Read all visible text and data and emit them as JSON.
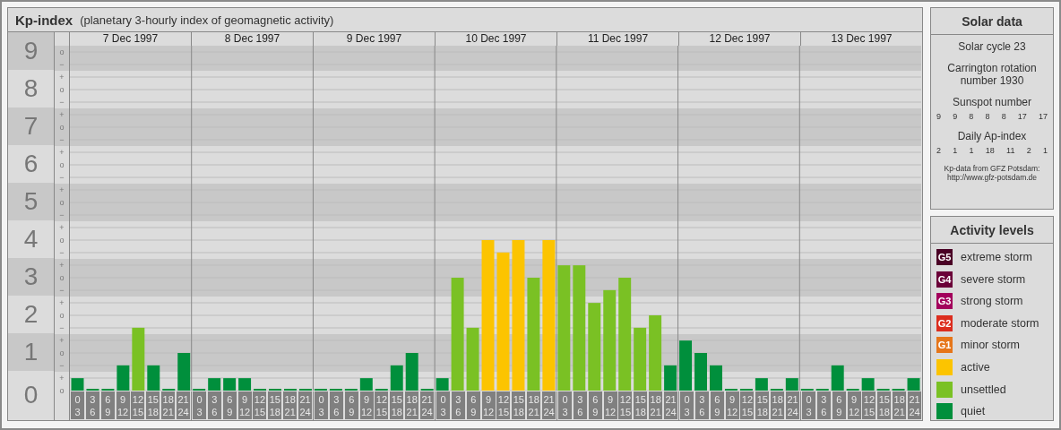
{
  "kp_panel": {
    "title": "Kp-index",
    "subtitle": "(planetary 3-hourly index of geomagnetic activity)",
    "sub_marks": [
      [
        "o",
        "−"
      ],
      [
        "+",
        "o",
        "−"
      ],
      [
        "+",
        "o",
        "−"
      ],
      [
        "+",
        "o",
        "−"
      ],
      [
        "+",
        "o",
        "−"
      ],
      [
        "+",
        "o",
        "−"
      ],
      [
        "+",
        "o",
        "−"
      ],
      [
        "+",
        "o",
        "−"
      ],
      [
        "+",
        "o",
        "−"
      ],
      [
        "+",
        "o"
      ]
    ],
    "days": [
      "7 Dec 1997",
      "8 Dec 1997",
      "9 Dec 1997",
      "10 Dec 1997",
      "11 Dec 1997",
      "12 Dec 1997",
      "13 Dec 1997"
    ],
    "chart_data": {
      "type": "bar",
      "stacked": true,
      "grid": true,
      "ylim": [
        0,
        9
      ],
      "bands": [
        {
          "axis": "y",
          "from": 0.5,
          "to": 1.5
        },
        {
          "axis": "y",
          "from": 2.5,
          "to": 3.5
        },
        {
          "axis": "y",
          "from": 4.5,
          "to": 5.5
        },
        {
          "axis": "y",
          "from": 6.5,
          "to": 7.5
        },
        {
          "axis": "y",
          "from": 8.5,
          "to": 9.5
        }
      ],
      "yticks": [
        {
          "value": 0,
          "label": "0"
        },
        {
          "value": 1,
          "label": "1"
        },
        {
          "value": 2,
          "label": "2"
        },
        {
          "value": 3,
          "label": "3"
        },
        {
          "value": 4,
          "label": "4"
        },
        {
          "value": 5,
          "label": "5"
        },
        {
          "value": 6,
          "label": "6"
        },
        {
          "value": 7,
          "label": "7"
        },
        {
          "value": 8,
          "label": "8"
        },
        {
          "value": 9,
          "label": "9"
        }
      ],
      "categories": [
        "0\n3",
        "3\n6",
        "6\n9",
        "9\n12",
        "12\n15",
        "15\n18",
        "18\n21",
        "21\n24",
        "0\n3",
        "3\n6",
        "6\n9",
        "9\n12",
        "12\n15",
        "15\n18",
        "18\n21",
        "21\n24",
        "0\n3",
        "3\n6",
        "6\n9",
        "9\n12",
        "12\n15",
        "15\n18",
        "18\n21",
        "21\n24",
        "0\n3",
        "3\n6",
        "6\n9",
        "9\n12",
        "12\n15",
        "15\n18",
        "18\n21",
        "21\n24",
        "0\n3",
        "3\n6",
        "6\n9",
        "9\n12",
        "12\n15",
        "15\n18",
        "18\n21",
        "21\n24",
        "0\n3",
        "3\n6",
        "6\n9",
        "9\n12",
        "12\n15",
        "15\n18",
        "18\n21",
        "21\n24",
        "0\n3",
        "3\n6",
        "6\n9",
        "9\n12",
        "12\n15",
        "15\n18",
        "18\n21",
        "21\n24"
      ],
      "series": [
        {
          "name": "active",
          "color": "#fcc400",
          "values": [
            null,
            null,
            null,
            null,
            null,
            null,
            null,
            null,
            null,
            null,
            null,
            null,
            null,
            null,
            null,
            null,
            null,
            null,
            null,
            null,
            null,
            null,
            null,
            null,
            null,
            null,
            null,
            4,
            3.67,
            4,
            null,
            4,
            null,
            null,
            null,
            null,
            null,
            null,
            null,
            null,
            null,
            null,
            null,
            null,
            null,
            null,
            null,
            null,
            null,
            null,
            null,
            null,
            null,
            null,
            null,
            null
          ]
        },
        {
          "name": "unsettled",
          "color": "#7ac124",
          "values": [
            null,
            null,
            null,
            null,
            1.67,
            null,
            null,
            null,
            null,
            null,
            null,
            null,
            null,
            null,
            null,
            null,
            null,
            null,
            null,
            null,
            null,
            null,
            null,
            null,
            null,
            3,
            1.67,
            null,
            null,
            null,
            3,
            null,
            3.33,
            3.33,
            2.33,
            2.67,
            3,
            1.67,
            2,
            null,
            null,
            null,
            null,
            null,
            null,
            null,
            null,
            null,
            null,
            null,
            null,
            null,
            null,
            null,
            null,
            null
          ]
        },
        {
          "name": "quiet",
          "color": "#008f3c",
          "values": [
            0.33,
            0,
            0,
            0.67,
            null,
            0.67,
            0,
            1,
            0,
            0.33,
            0.33,
            0.33,
            0,
            0,
            0,
            0,
            0,
            0,
            0,
            0.33,
            0,
            0.67,
            1,
            0,
            0.33,
            null,
            null,
            null,
            null,
            null,
            null,
            null,
            null,
            null,
            null,
            null,
            null,
            null,
            null,
            0.67,
            1.33,
            1,
            0.67,
            0,
            0,
            0.33,
            0,
            0.33,
            0,
            0,
            0.67,
            0,
            0.33,
            0,
            0,
            0.33
          ]
        }
      ]
    }
  },
  "solar_data": {
    "title": "Solar data",
    "solar_cycle": "Solar cycle 23",
    "carrington": "Carrington rotation number 1930",
    "sunspot_label": "Sunspot number",
    "sunspot_values": [
      "9",
      "9",
      "8",
      "8",
      "8",
      "17",
      "17"
    ],
    "ap_label": "Daily Ap-index",
    "ap_values": [
      "2",
      "1",
      "1",
      "18",
      "11",
      "2",
      "1"
    ],
    "credit_lines": [
      "Kp-data from GFZ Potsdam:",
      "http://www.gfz-potsdam.de"
    ]
  },
  "activity_levels": {
    "title": "Activity levels",
    "items": [
      {
        "badge": "G5",
        "label": "extreme storm",
        "color": "#4a0025"
      },
      {
        "badge": "G4",
        "label": "severe storm",
        "color": "#6a0038"
      },
      {
        "badge": "G3",
        "label": "strong storm",
        "color": "#a3005c"
      },
      {
        "badge": "G2",
        "label": "moderate storm",
        "color": "#dc2d1e"
      },
      {
        "badge": "G1",
        "label": "minor storm",
        "color": "#e6761a"
      }
    ]
  }
}
